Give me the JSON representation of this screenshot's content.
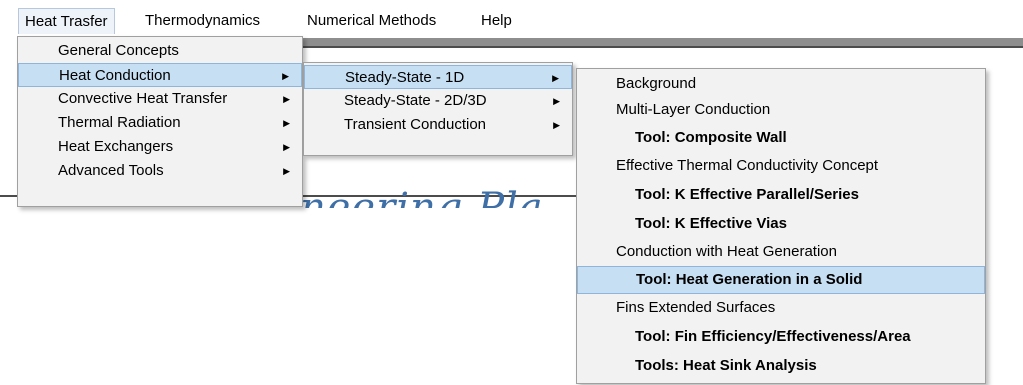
{
  "menubar": {
    "items": [
      {
        "label": "Heat Trasfer"
      },
      {
        "label": "Thermodynamics"
      },
      {
        "label": "Numerical Methods"
      },
      {
        "label": "Help"
      }
    ]
  },
  "heat_transfer_menu": {
    "items": [
      {
        "label": "General Concepts"
      },
      {
        "label": "Heat Conduction"
      },
      {
        "label": "Convective Heat Transfer"
      },
      {
        "label": "Thermal Radiation"
      },
      {
        "label": "Heat Exchangers"
      },
      {
        "label": "Advanced Tools"
      }
    ]
  },
  "conduction_menu": {
    "items": [
      {
        "label": "Steady-State - 1D"
      },
      {
        "label": "Steady-State - 2D/3D"
      },
      {
        "label": "Transient Conduction"
      }
    ]
  },
  "steady_1d_menu": {
    "items": [
      {
        "label": "Background"
      },
      {
        "label": "Multi-Layer Conduction"
      },
      {
        "label": "Tool: Composite Wall"
      },
      {
        "label": "Effective Thermal Conductivity Concept"
      },
      {
        "label": "Tool: K Effective Parallel/Series"
      },
      {
        "label": "Tool: K Effective Vias"
      },
      {
        "label": "Conduction with Heat Generation"
      },
      {
        "label": "Tool: Heat Generation in a Solid"
      },
      {
        "label": "Fins  Extended Surfaces"
      },
      {
        "label": "Tool: Fin Efficiency/Effectiveness/Area"
      },
      {
        "label": "Tools: Heat Sink Analysis"
      }
    ]
  },
  "background": {
    "banner_text": "neering Pla"
  },
  "colors": {
    "highlight": "#c6dff3",
    "highlight_border": "#8fb6da",
    "menu_bg": "#f2f2f2",
    "banner": "#3e6fa6"
  }
}
